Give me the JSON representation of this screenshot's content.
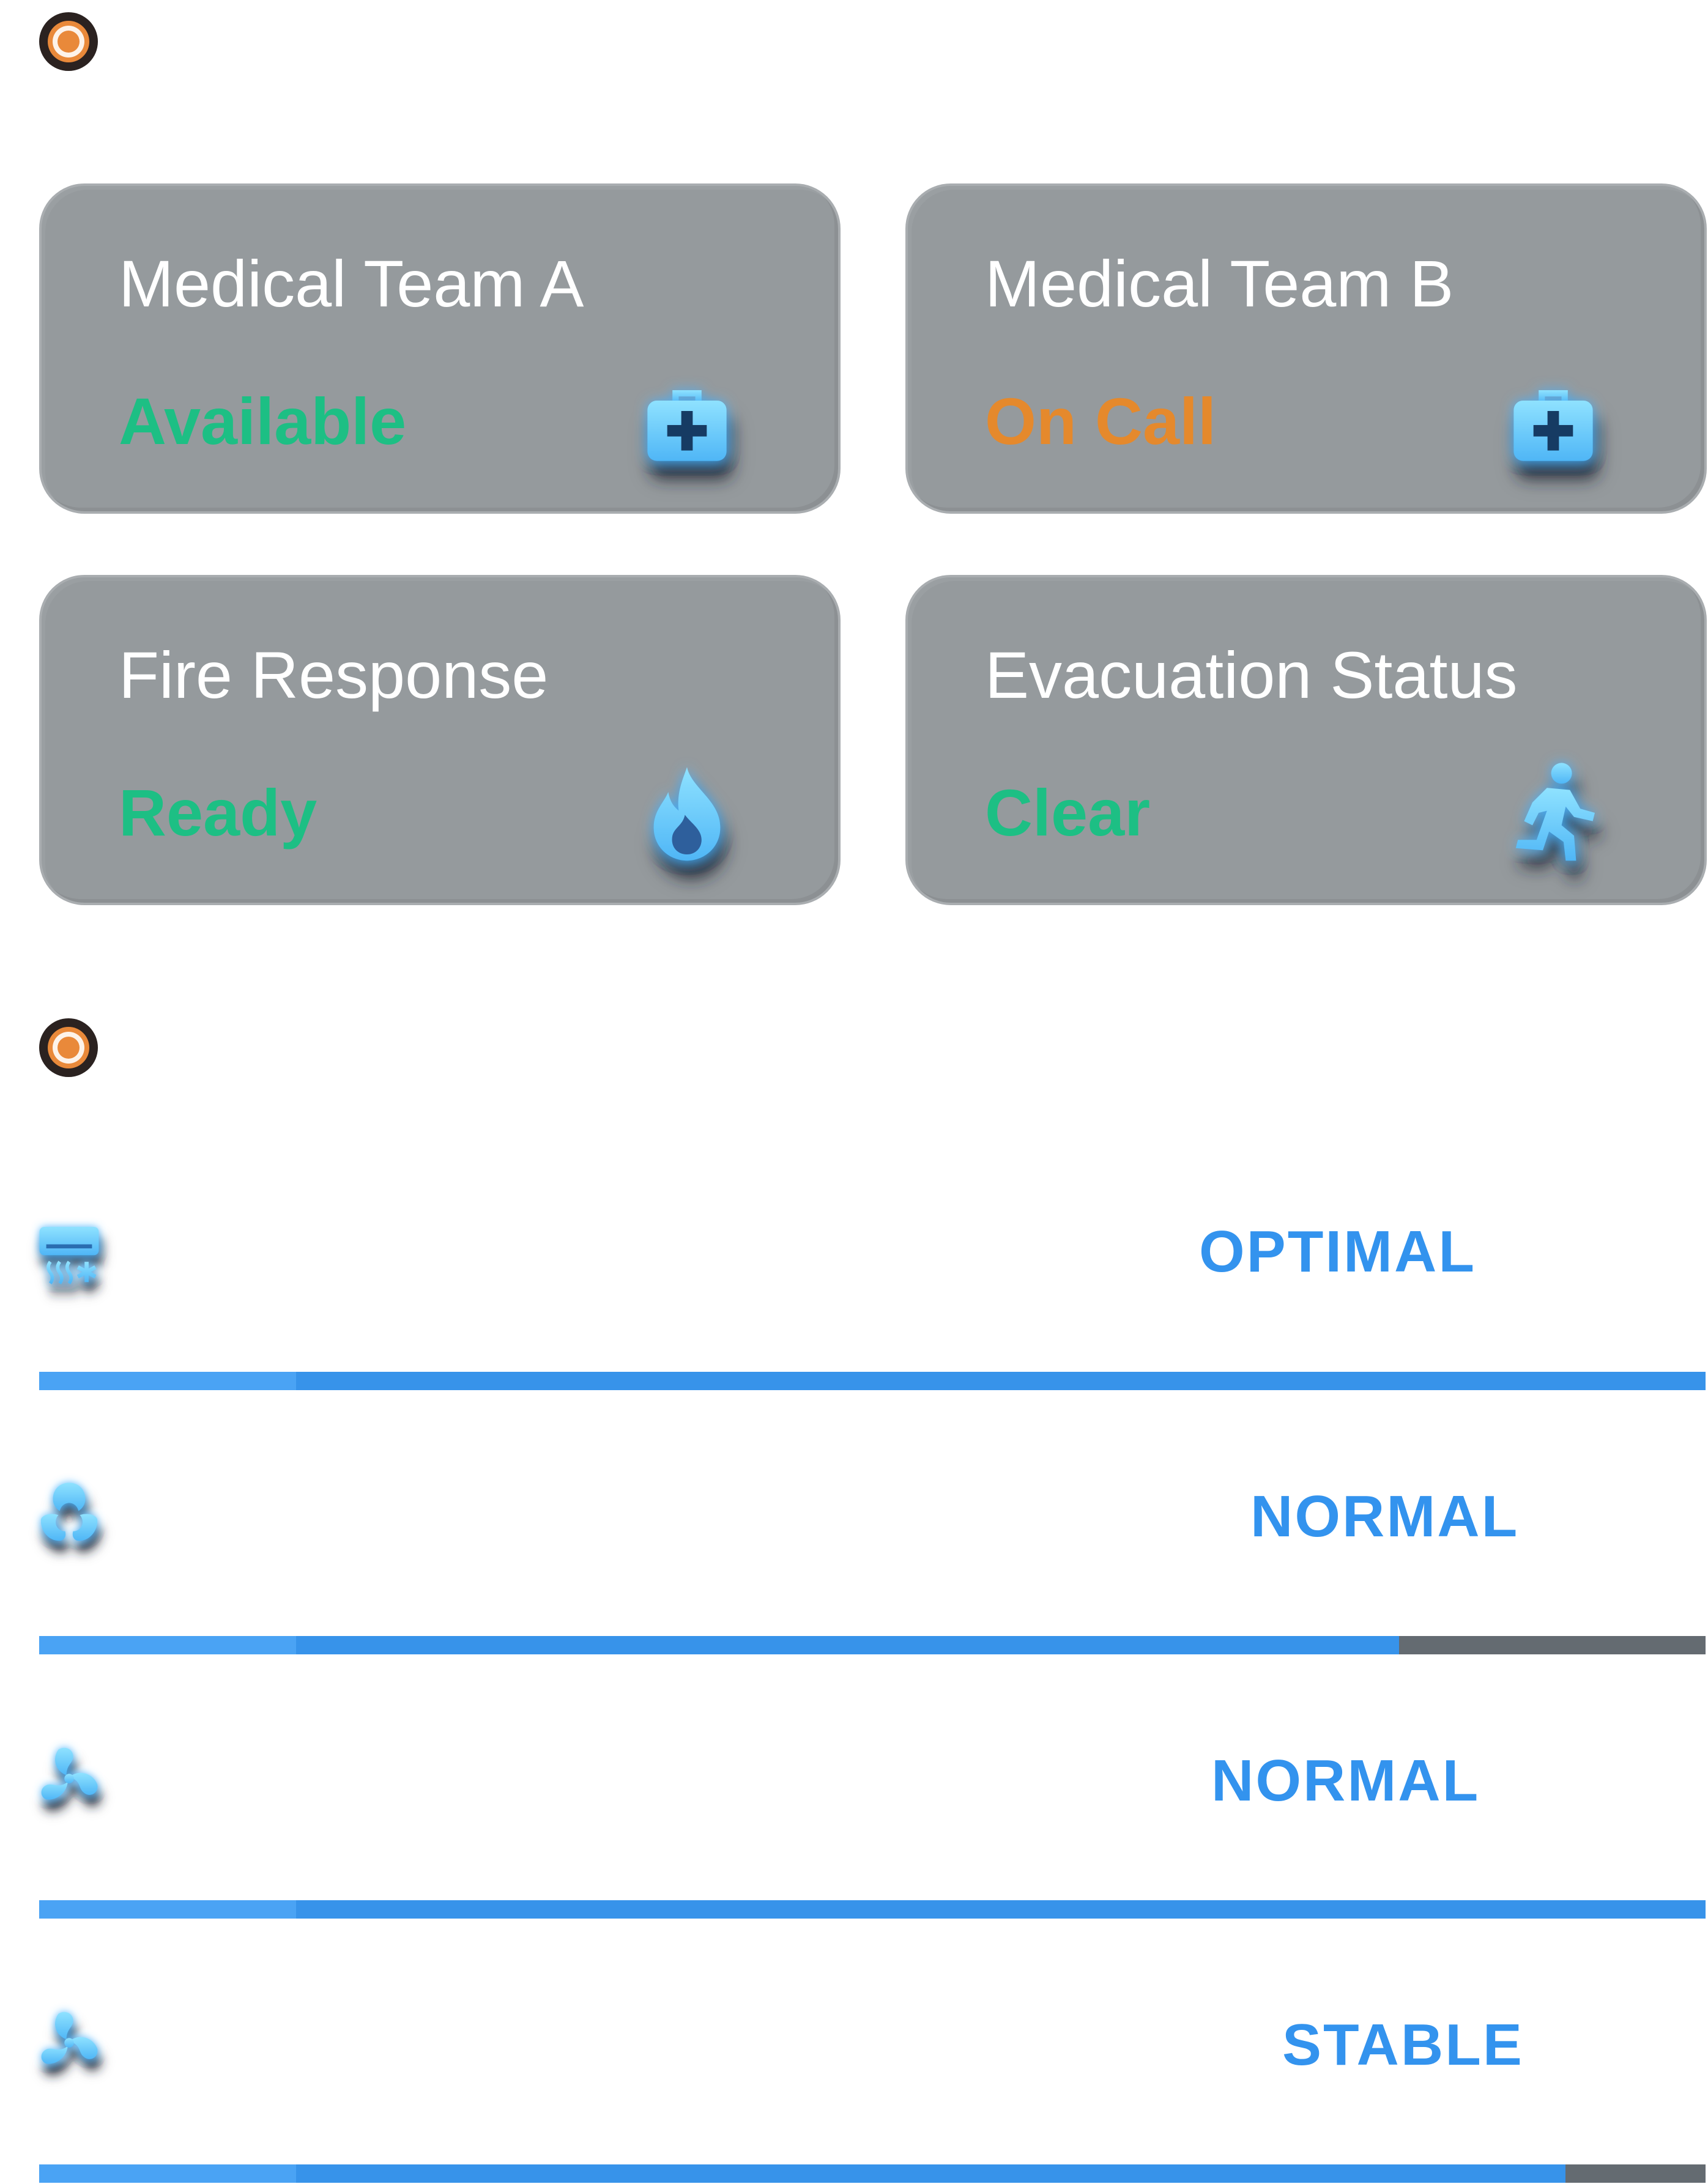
{
  "cards": [
    {
      "title": "Medical Team A",
      "status": "Available",
      "status_color": "#1dbf84",
      "icon": "medical-kit-icon"
    },
    {
      "title": "Medical Team B",
      "status": "On Call",
      "status_color": "#e5892c",
      "icon": "medical-kit-icon"
    },
    {
      "title": "Fire Response",
      "status": "Ready",
      "status_color": "#1dbf84",
      "icon": "fire-icon"
    },
    {
      "title": "Evacuation Status",
      "status": "Clear",
      "status_color": "#1dbf84",
      "icon": "running-person-icon"
    }
  ],
  "systems": [
    {
      "icon": "air-conditioner-icon",
      "status": "OPTIMAL",
      "level": 1.0
    },
    {
      "icon": "hazard-symbol-icon",
      "status": "NORMAL",
      "level": 0.816
    },
    {
      "icon": "fan-icon",
      "status": "NORMAL",
      "level": 1.0
    },
    {
      "icon": "fan-icon",
      "status": "STABLE",
      "level": 0.916
    }
  ],
  "colors": {
    "accent": "#3393ee",
    "card_background": "#959a9d",
    "bar_track": "#646b71",
    "icon_glow": "#7fd3ff"
  }
}
